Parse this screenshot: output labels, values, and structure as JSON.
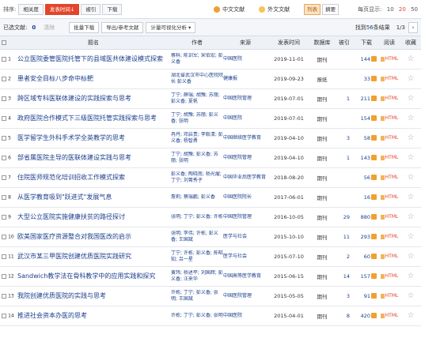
{
  "sort": {
    "label": "排序:",
    "options": [
      "相关度",
      "发表时间",
      "被引",
      "下载"
    ],
    "active_index": 1,
    "active_arrow": "↓"
  },
  "language": {
    "zh": "中文文献",
    "foreign": "外文文献"
  },
  "views": {
    "list": "列表",
    "summary": "摘要"
  },
  "per_page": {
    "label": "每页显示:",
    "options": [
      "10",
      "20",
      "50"
    ]
  },
  "toolbar": {
    "selected_label": "已选文献:",
    "selected_count": "0",
    "clear": "清除",
    "batch_download": "批量下载",
    "export": "导出/参考文献",
    "visualize": "计量可视化分析",
    "visualize_arrow": "▾",
    "found_prefix": "找到",
    "found_count": "56",
    "found_suffix": "条结果",
    "page": "1/3",
    "next": "›"
  },
  "columns": [
    "题名",
    "作者",
    "来源",
    "发表时间",
    "数据库",
    "被引",
    "下载",
    "阅读",
    "收藏"
  ],
  "accent_color": "#e2452b",
  "link_color": "#1a3e8c",
  "rows": [
    {
      "num": "1",
      "title": "公立医院委管医院托管下的县域医共体建设模式探索",
      "author": "蔡科; 陈训军; 宋伯宏; 彭义香",
      "source": "中国医院",
      "date": "2019-11-01",
      "db": "期刊",
      "cite": "",
      "download": "144",
      "read": "HTML"
    },
    {
      "num": "2",
      "title": "患者安全目标八步命中标靶",
      "author": "湖北省武汉市中心医院院长 彭义香",
      "source": "健康报",
      "date": "2019-09-23",
      "db": "报纸",
      "cite": "",
      "download": "33",
      "read": "HTML"
    },
    {
      "num": "3",
      "title": "跨区域专科医联体建设的实践探索与思考",
      "author": "丁宁; 薛瑞; 胡豫; 苏丽; 彭义香; 夏帆",
      "source": "中国医院管理",
      "date": "2019-07-01",
      "db": "期刊",
      "cite": "1",
      "download": "211",
      "read": "HTML"
    },
    {
      "num": "4",
      "title": "政府医院合作模式下三级医院托管实践探索与思考",
      "author": "丁宁; 胡豫; 苏丽; 彭义香; 张明",
      "source": "中国医院",
      "date": "2019-07-01",
      "db": "期刊",
      "cite": "",
      "download": "154",
      "read": "HTML"
    },
    {
      "num": "5",
      "title": "医学留学生外科手术学全英教学的思考",
      "author": "冉丹; 邓启贵; 李毅清; 彭义香; 杨智勇",
      "source": "中国继续医学教育",
      "date": "2019-04-10",
      "db": "期刊",
      "cite": "3",
      "download": "58",
      "read": "HTML"
    },
    {
      "num": "6",
      "title": "部省属医院主导的医联体建设实践与思考",
      "author": "丁宁; 胡豫; 彭义香; 苏丽; 张明",
      "source": "中国医院管理",
      "date": "2019-04-10",
      "db": "期刊",
      "cite": "1",
      "download": "143",
      "read": "HTML"
    },
    {
      "num": "7",
      "title": "住院医师规范化培训招收工作模式探索",
      "author": "彭义香; 陶晓南; 杨光燿; 丁宁; 刘菁秀子",
      "source": "中国毕业后医学教育",
      "date": "2018-08-20",
      "db": "期刊",
      "cite": "",
      "download": "56",
      "read": "HTML"
    },
    {
      "num": "8",
      "title": "从医学教育吸到\"跃进式\"发展气息",
      "author": "詹莉; 蔡瑞鹏; 彭义香",
      "source": "中国医院院长",
      "date": "2017-06-01",
      "db": "期刊",
      "cite": "",
      "download": "16",
      "read": "HTML"
    },
    {
      "num": "9",
      "title": "大型公立医院实施健康扶贫的路径探讨",
      "author": "张明; 丁宁; 彭义香; 许栋",
      "source": "中国医院管理",
      "date": "2016-10-05",
      "db": "期刊",
      "cite": "29",
      "download": "880",
      "read": "HTML"
    },
    {
      "num": "10",
      "title": "欧美国家医疗资源整合对我国医改的启示",
      "author": "张明; 李伟; 许栋; 彭义香; 王国斌",
      "source": "医学与社会",
      "date": "2015-10-10",
      "db": "期刊",
      "cite": "11",
      "download": "293",
      "read": "HTML"
    },
    {
      "num": "11",
      "title": "武汉市某三甲医院创建优质医院实践研究",
      "author": "丁宁; 许栋; 彭义香; 陈昭知; 吕一星",
      "source": "医学与社会",
      "date": "2015-07-10",
      "db": "期刊",
      "cite": "2",
      "download": "60",
      "read": "HTML"
    },
    {
      "num": "12",
      "title": "Sandwich教学法在骨科教学中的应用实践和探究",
      "author": "黄玮; 杨述平; 刘国辉; 彭义香; 汪来华",
      "source": "中国高等医学教育",
      "date": "2015-06-15",
      "db": "期刊",
      "cite": "14",
      "download": "157",
      "read": "HTML"
    },
    {
      "num": "13",
      "title": "我院创建优质医院的实践与思考",
      "author": "许栋; 丁宁; 彭义香; 张明; 王国斌",
      "source": "中国医院管理",
      "date": "2015-05-05",
      "db": "期刊",
      "cite": "3",
      "download": "91",
      "read": "HTML"
    },
    {
      "num": "14",
      "title": "推进社会资本办医的思考",
      "author": "许栋; 丁宁; 彭义香; 张明",
      "source": "中国医院",
      "date": "2015-04-01",
      "db": "期刊",
      "cite": "8",
      "download": "420",
      "read": "HTML"
    }
  ]
}
